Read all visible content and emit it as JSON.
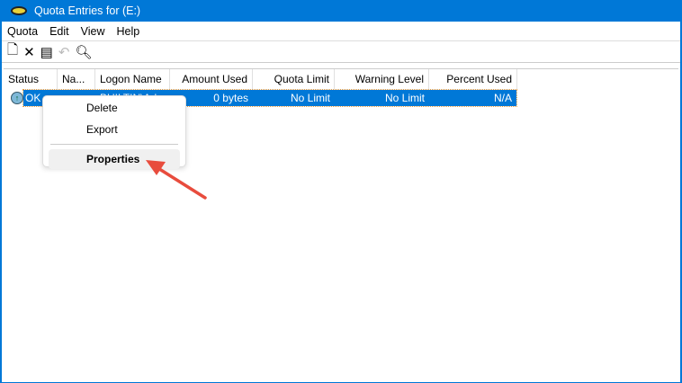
{
  "window": {
    "title": "Quota Entries for  (E:)"
  },
  "menu": [
    "Quota",
    "Edit",
    "View",
    "Help"
  ],
  "columns": [
    "Status",
    "Na...",
    "Logon Name",
    "Amount Used",
    "Quota Limit",
    "Warning Level",
    "Percent Used"
  ],
  "row": {
    "status": "OK",
    "name": "",
    "logon": "BUILTIN\\Ad...",
    "amount": "0 bytes",
    "quota": "No Limit",
    "warning": "No Limit",
    "percent": "N/A"
  },
  "context_menu": {
    "items": [
      "Delete",
      "Export"
    ],
    "properties": "Properties"
  },
  "colors": {
    "accent": "#0078d7",
    "arrow": "#e84c3d"
  }
}
